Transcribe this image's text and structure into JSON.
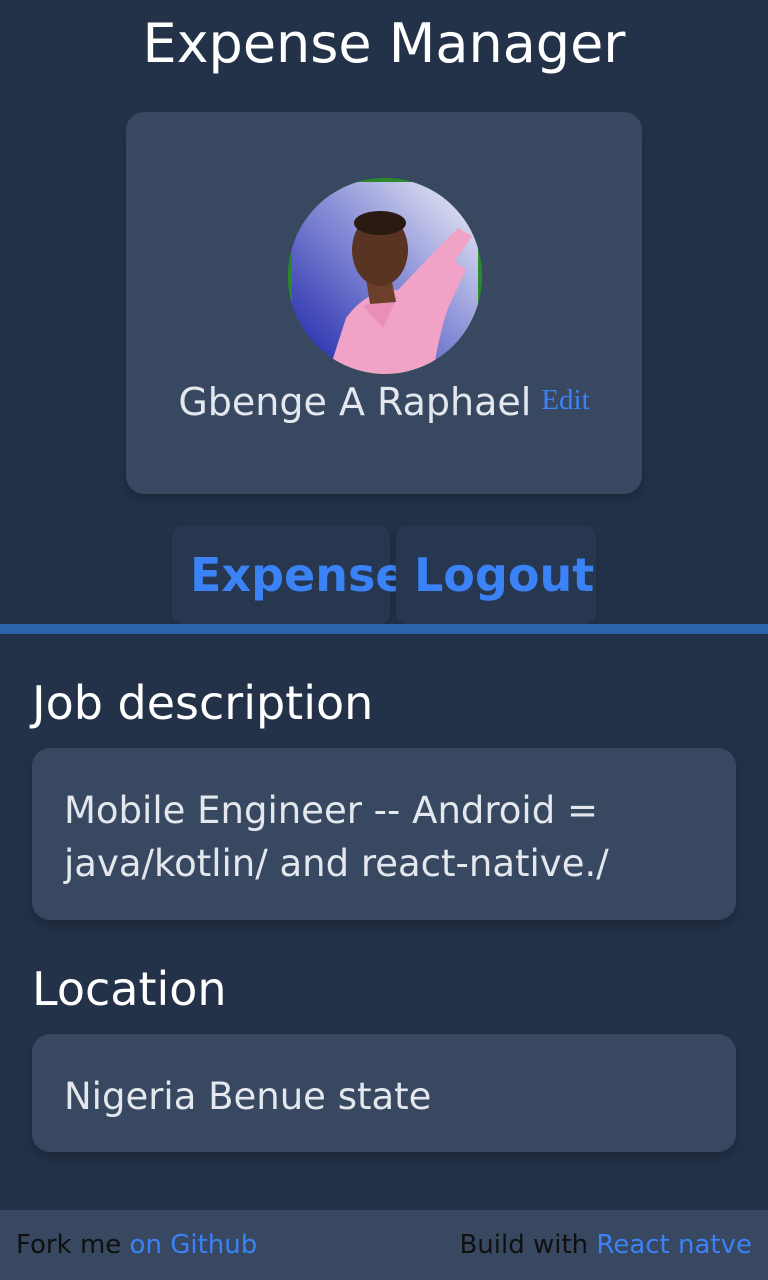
{
  "app": {
    "title": "Expense Manager"
  },
  "profile": {
    "name": "Gbenge A Raphael",
    "edit_label": "Edit",
    "avatar_icon": "user-photo"
  },
  "nav": {
    "expense_label": "Expense",
    "logout_label": "Logout"
  },
  "job": {
    "label": "Job description",
    "value": "Mobile Engineer -- Android = java/kotlin/ and react-native./"
  },
  "location": {
    "label": "Location",
    "value": "Nigeria Benue state"
  },
  "footer": {
    "fork_text": "Fork me",
    "fork_link": "on Github",
    "build_text": "Build with",
    "build_link": "React natve"
  },
  "colors": {
    "background": "#243249",
    "card": "#374860",
    "accent": "#3b82f6",
    "divider": "#2b63ad"
  }
}
